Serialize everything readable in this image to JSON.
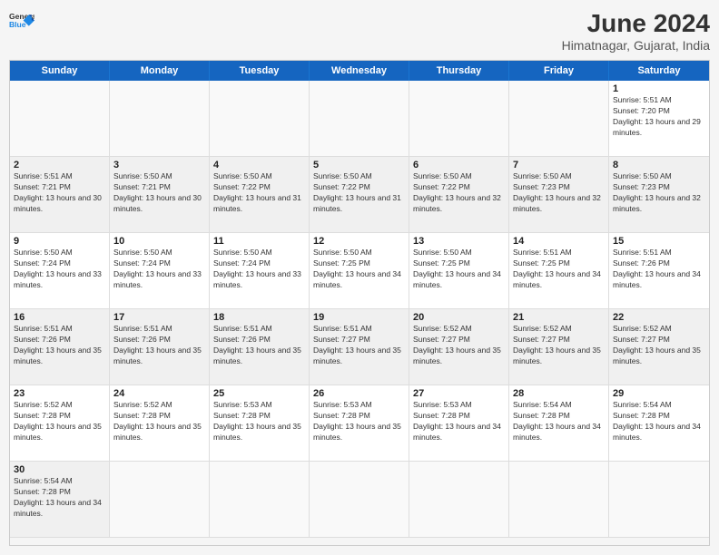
{
  "header": {
    "logo_general": "General",
    "logo_blue": "Blue",
    "month": "June 2024",
    "location": "Himatnagar, Gujarat, India"
  },
  "days": [
    "Sunday",
    "Monday",
    "Tuesday",
    "Wednesday",
    "Thursday",
    "Friday",
    "Saturday"
  ],
  "cells": [
    {
      "day": null,
      "empty": true
    },
    {
      "day": null,
      "empty": true
    },
    {
      "day": null,
      "empty": true
    },
    {
      "day": null,
      "empty": true
    },
    {
      "day": null,
      "empty": true
    },
    {
      "day": null,
      "empty": true
    },
    {
      "day": "1",
      "sunrise": "5:51 AM",
      "sunset": "7:20 PM",
      "daylight": "13 hours and 29 minutes."
    },
    {
      "day": "2",
      "sunrise": "5:51 AM",
      "sunset": "7:21 PM",
      "daylight": "13 hours and 30 minutes."
    },
    {
      "day": "3",
      "sunrise": "5:50 AM",
      "sunset": "7:21 PM",
      "daylight": "13 hours and 30 minutes."
    },
    {
      "day": "4",
      "sunrise": "5:50 AM",
      "sunset": "7:22 PM",
      "daylight": "13 hours and 31 minutes."
    },
    {
      "day": "5",
      "sunrise": "5:50 AM",
      "sunset": "7:22 PM",
      "daylight": "13 hours and 31 minutes."
    },
    {
      "day": "6",
      "sunrise": "5:50 AM",
      "sunset": "7:22 PM",
      "daylight": "13 hours and 32 minutes."
    },
    {
      "day": "7",
      "sunrise": "5:50 AM",
      "sunset": "7:23 PM",
      "daylight": "13 hours and 32 minutes."
    },
    {
      "day": "8",
      "sunrise": "5:50 AM",
      "sunset": "7:23 PM",
      "daylight": "13 hours and 32 minutes."
    },
    {
      "day": "9",
      "sunrise": "5:50 AM",
      "sunset": "7:24 PM",
      "daylight": "13 hours and 33 minutes."
    },
    {
      "day": "10",
      "sunrise": "5:50 AM",
      "sunset": "7:24 PM",
      "daylight": "13 hours and 33 minutes."
    },
    {
      "day": "11",
      "sunrise": "5:50 AM",
      "sunset": "7:24 PM",
      "daylight": "13 hours and 33 minutes."
    },
    {
      "day": "12",
      "sunrise": "5:50 AM",
      "sunset": "7:25 PM",
      "daylight": "13 hours and 34 minutes."
    },
    {
      "day": "13",
      "sunrise": "5:50 AM",
      "sunset": "7:25 PM",
      "daylight": "13 hours and 34 minutes."
    },
    {
      "day": "14",
      "sunrise": "5:51 AM",
      "sunset": "7:25 PM",
      "daylight": "13 hours and 34 minutes."
    },
    {
      "day": "15",
      "sunrise": "5:51 AM",
      "sunset": "7:26 PM",
      "daylight": "13 hours and 34 minutes."
    },
    {
      "day": "16",
      "sunrise": "5:51 AM",
      "sunset": "7:26 PM",
      "daylight": "13 hours and 35 minutes."
    },
    {
      "day": "17",
      "sunrise": "5:51 AM",
      "sunset": "7:26 PM",
      "daylight": "13 hours and 35 minutes."
    },
    {
      "day": "18",
      "sunrise": "5:51 AM",
      "sunset": "7:26 PM",
      "daylight": "13 hours and 35 minutes."
    },
    {
      "day": "19",
      "sunrise": "5:51 AM",
      "sunset": "7:27 PM",
      "daylight": "13 hours and 35 minutes."
    },
    {
      "day": "20",
      "sunrise": "5:52 AM",
      "sunset": "7:27 PM",
      "daylight": "13 hours and 35 minutes."
    },
    {
      "day": "21",
      "sunrise": "5:52 AM",
      "sunset": "7:27 PM",
      "daylight": "13 hours and 35 minutes."
    },
    {
      "day": "22",
      "sunrise": "5:52 AM",
      "sunset": "7:27 PM",
      "daylight": "13 hours and 35 minutes."
    },
    {
      "day": "23",
      "sunrise": "5:52 AM",
      "sunset": "7:28 PM",
      "daylight": "13 hours and 35 minutes."
    },
    {
      "day": "24",
      "sunrise": "5:52 AM",
      "sunset": "7:28 PM",
      "daylight": "13 hours and 35 minutes."
    },
    {
      "day": "25",
      "sunrise": "5:53 AM",
      "sunset": "7:28 PM",
      "daylight": "13 hours and 35 minutes."
    },
    {
      "day": "26",
      "sunrise": "5:53 AM",
      "sunset": "7:28 PM",
      "daylight": "13 hours and 35 minutes."
    },
    {
      "day": "27",
      "sunrise": "5:53 AM",
      "sunset": "7:28 PM",
      "daylight": "13 hours and 34 minutes."
    },
    {
      "day": "28",
      "sunrise": "5:54 AM",
      "sunset": "7:28 PM",
      "daylight": "13 hours and 34 minutes."
    },
    {
      "day": "29",
      "sunrise": "5:54 AM",
      "sunset": "7:28 PM",
      "daylight": "13 hours and 34 minutes."
    },
    {
      "day": "30",
      "sunrise": "5:54 AM",
      "sunset": "7:28 PM",
      "daylight": "13 hours and 34 minutes."
    },
    {
      "day": null,
      "empty": true
    },
    {
      "day": null,
      "empty": true
    },
    {
      "day": null,
      "empty": true
    },
    {
      "day": null,
      "empty": true
    },
    {
      "day": null,
      "empty": true
    },
    {
      "day": null,
      "empty": true
    }
  ]
}
